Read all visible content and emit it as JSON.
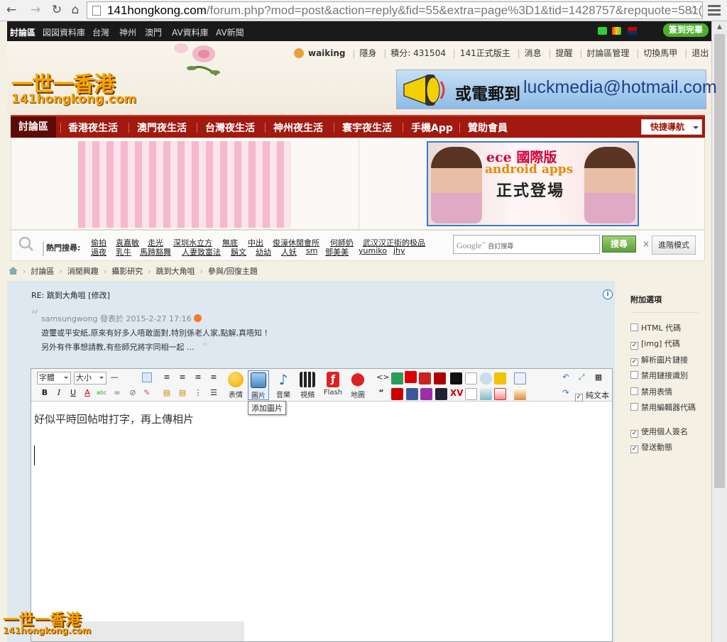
{
  "browser": {
    "url_host": "141hongkong.com",
    "url_path": "/forum.php?mod=post&action=reply&fid=55&extra=page%3D1&tid=1428757&repquote=581("
  },
  "topbar": {
    "items": [
      "討論區",
      "図図資料庫",
      "台灣",
      "神州",
      "澳門",
      "AV資料庫",
      "AV新聞"
    ],
    "sign_badge": "簽到完畢"
  },
  "header": {
    "logo_cn": "一世一香港",
    "logo_en": "141hongkong.com",
    "username": "waiking",
    "user_links": [
      "隱身",
      "積分: 431504",
      "141正式版主",
      "消息",
      "提醒",
      "討論區管理",
      "切換馬甲",
      "退出"
    ],
    "ad_mail_prefix": "或電郵到",
    "ad_mail_email": "luckmedia@hotmail.com"
  },
  "mainnav": {
    "items": [
      "討論區",
      "香港夜生活",
      "澳門夜生活",
      "台灣夜生活",
      "神州夜生活",
      "寰宇夜生活",
      "手機App",
      "贊助會員"
    ],
    "quicknav": "快捷導航"
  },
  "ad_ece": {
    "line1": "ece 國際版",
    "line2": "android apps",
    "line3": "正式登場"
  },
  "search": {
    "hot_label": "熱門搜尋:",
    "row1": [
      "偷拍",
      "袁嘉敏",
      "走光",
      "深圳水立方",
      "無底",
      "中出",
      "俊濠休閒會所",
      "何師奶",
      "武汉汉正街的极品"
    ],
    "row2": [
      "過夜",
      "乳牛",
      "馬蹄豁舞",
      "人妻致富法",
      "鬍文",
      "幼幼",
      "人妖",
      "sm",
      "鄧美美",
      "yumiko",
      "jhy"
    ],
    "google_label": "Google",
    "custom_label": "自訂搜尋",
    "search_button": "搜尋",
    "close_glyph": "×",
    "advanced_button": "進階模式"
  },
  "breadcrumb": [
    "討論區",
    "消閒興趣",
    "攝影研究",
    "跳到大角咀",
    "參與/回復主題"
  ],
  "post": {
    "title": "RE: 跳到大角咀 [修改]",
    "quote_author": "samsungwong 發表於 2015-2-27 17:16",
    "quote_line1": "遊璽或平安紙,原來有好多人唔敢面對,特別係老人家,點解,真唔知 !",
    "quote_line2": "另外有件事想請教,有些師兄將字同相一起 ...",
    "close_quote": "”"
  },
  "editor": {
    "font_select": "字體",
    "size_select": "大小",
    "big_icons": [
      "表情",
      "圖片",
      "音樂",
      "視頻",
      "Flash",
      "地圖"
    ],
    "plain_text_label": "純文本",
    "tooltip": "添加圖片",
    "content": "好似平時回帖咁打字，再上傳相片"
  },
  "sidebar": {
    "title": "附加選項",
    "options": [
      {
        "label": "HTML 代碼",
        "checked": false
      },
      {
        "label": "[img] 代碼",
        "checked": true
      },
      {
        "label": "解析圖片鏈接",
        "checked": true
      },
      {
        "label": "禁用鏈接識別",
        "checked": false
      },
      {
        "label": "禁用表情",
        "checked": false
      },
      {
        "label": "禁用編輯器代碼",
        "checked": false
      },
      {
        "label": "使用個人簽名",
        "checked": true
      },
      {
        "label": "發送動態",
        "checked": true
      }
    ]
  },
  "watermark": {
    "cn": "一世一香港",
    "en": "141hongkong.com"
  },
  "colors": {
    "nav_red": "#a1190f",
    "logo_orange": "#f5a300",
    "panel_blue": "#dde8f1"
  }
}
